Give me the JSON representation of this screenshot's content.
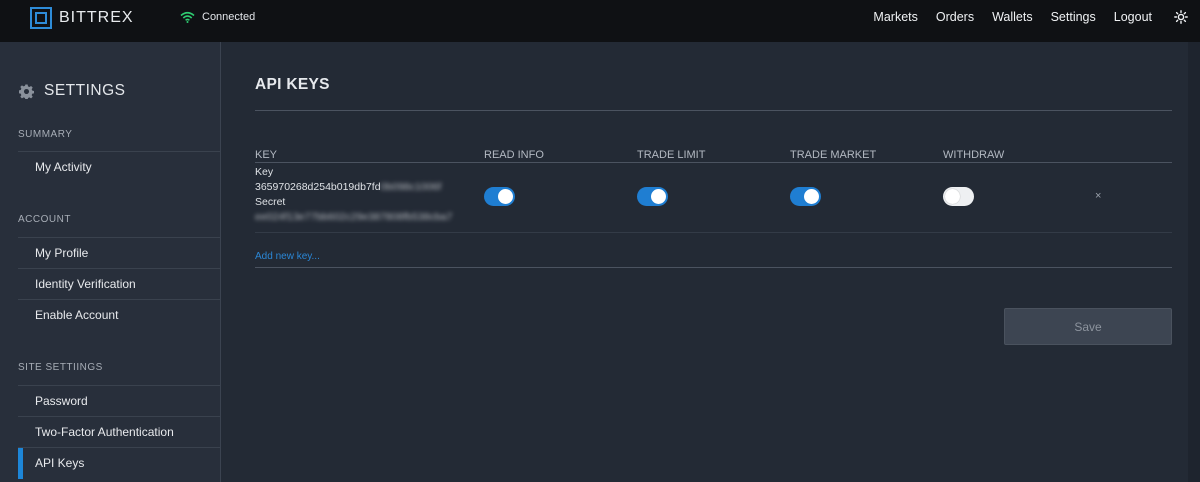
{
  "brand": {
    "name": "BITTREX",
    "accent": "#2e8cd8"
  },
  "connection": {
    "status": "Connected",
    "icon": "wifi-icon",
    "color": "#2ecc71"
  },
  "nav": {
    "items": [
      "Markets",
      "Orders",
      "Wallets",
      "Settings",
      "Logout"
    ],
    "theme_icon": "sun-icon"
  },
  "sidebar": {
    "title": "SETTINGS",
    "title_icon": "gear-icon",
    "sections": [
      {
        "label": "SUMMARY",
        "items": [
          "My Activity"
        ]
      },
      {
        "label": "ACCOUNT",
        "items": [
          "My Profile",
          "Identity Verification",
          "Enable Account"
        ]
      },
      {
        "label": "SITE SETTIINGS",
        "items": [
          "Password",
          "Two-Factor Authentication",
          "API Keys"
        ]
      }
    ],
    "active_item": "API Keys"
  },
  "main": {
    "title": "API KEYS",
    "columns": [
      "KEY",
      "READ INFO",
      "TRADE LIMIT",
      "TRADE MARKET",
      "WITHDRAW"
    ],
    "rows": [
      {
        "key_label": "Key",
        "key_visible": "365970268d254b019db7fd",
        "key_hidden": "0b098c1006f",
        "secret_label": "Secret",
        "secret_hidden": "ee024f13e77bb602c29e387808fb538cba7",
        "read_info": true,
        "trade_limit": true,
        "trade_market": true,
        "withdraw": false,
        "remove_icon": "close-icon",
        "remove_label": "×"
      }
    ],
    "add_new_key": "Add new key...",
    "save_label": "Save"
  },
  "colors": {
    "toggle_on": "#1f7ed2",
    "link": "#2b87d6",
    "active_indicator": "#1d86d8"
  }
}
